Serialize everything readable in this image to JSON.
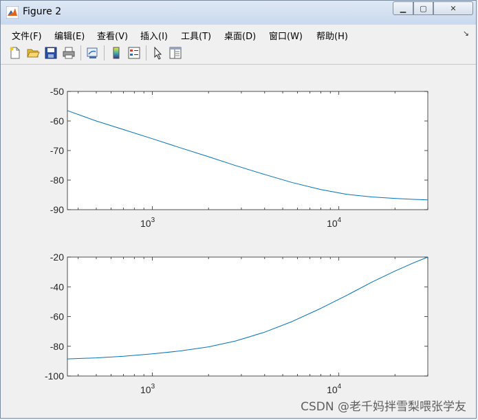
{
  "window": {
    "title": "Figure 2",
    "minimize_glyph": "▁",
    "maximize_glyph": "▢",
    "close_glyph": "✕"
  },
  "menu": [
    {
      "label": "文件(F)"
    },
    {
      "label": "编辑(E)"
    },
    {
      "label": "查看(V)"
    },
    {
      "label": "插入(I)"
    },
    {
      "label": "工具(T)"
    },
    {
      "label": "桌面(D)"
    },
    {
      "label": "窗口(W)"
    },
    {
      "label": "帮助(H)"
    }
  ],
  "menu_dock_glyph": "↘",
  "toolbar": [
    {
      "icon": "new-figure-icon"
    },
    {
      "icon": "open-file-icon"
    },
    {
      "icon": "save-icon"
    },
    {
      "icon": "print-icon"
    },
    {
      "icon": "link-plot-icon"
    },
    {
      "icon": "colorbar-icon"
    },
    {
      "icon": "legend-icon"
    },
    {
      "icon": "pointer-icon"
    },
    {
      "icon": "property-inspector-icon"
    }
  ],
  "chart_data": [
    {
      "type": "line",
      "xscale": "log",
      "xlim": [
        350,
        30000
      ],
      "ylim": [
        -90,
        -50
      ],
      "yticks": [
        -50,
        -60,
        -70,
        -80,
        -90
      ],
      "xticks": [
        1000,
        10000
      ],
      "xtick_labels": [
        {
          "base": "10",
          "exp": "3"
        },
        {
          "base": "10",
          "exp": "4"
        }
      ],
      "line_color": "#0072bd",
      "series": [
        {
          "x": [
            350,
            500,
            700,
            1000,
            1400,
            2000,
            2800,
            4000,
            5600,
            8000,
            11000,
            15000,
            20000,
            25000,
            30000
          ],
          "y": [
            -56.5,
            -60.0,
            -62.9,
            -66.0,
            -69.0,
            -72.1,
            -75.1,
            -78.1,
            -80.8,
            -83.2,
            -84.8,
            -85.7,
            -86.2,
            -86.5,
            -86.7
          ]
        }
      ]
    },
    {
      "type": "line",
      "xscale": "log",
      "xlim": [
        350,
        30000
      ],
      "ylim": [
        -100,
        -20
      ],
      "yticks": [
        -20,
        -40,
        -60,
        -80,
        -100
      ],
      "xticks": [
        1000,
        10000
      ],
      "xtick_labels": [
        {
          "base": "10",
          "exp": "3"
        },
        {
          "base": "10",
          "exp": "4"
        }
      ],
      "line_color": "#0072bd",
      "series": [
        {
          "x": [
            350,
            500,
            700,
            1000,
            1400,
            2000,
            2800,
            4000,
            5600,
            8000,
            11000,
            15000,
            20000,
            25000,
            30000
          ],
          "y": [
            -88.5,
            -87.8,
            -86.7,
            -85.1,
            -83.2,
            -80.4,
            -76.4,
            -70.5,
            -63.4,
            -54.5,
            -45.8,
            -36.9,
            -29.4,
            -24.0,
            -20.0
          ]
        }
      ]
    }
  ],
  "watermark": "CSDN @老千妈拌雪梨喂张学友"
}
